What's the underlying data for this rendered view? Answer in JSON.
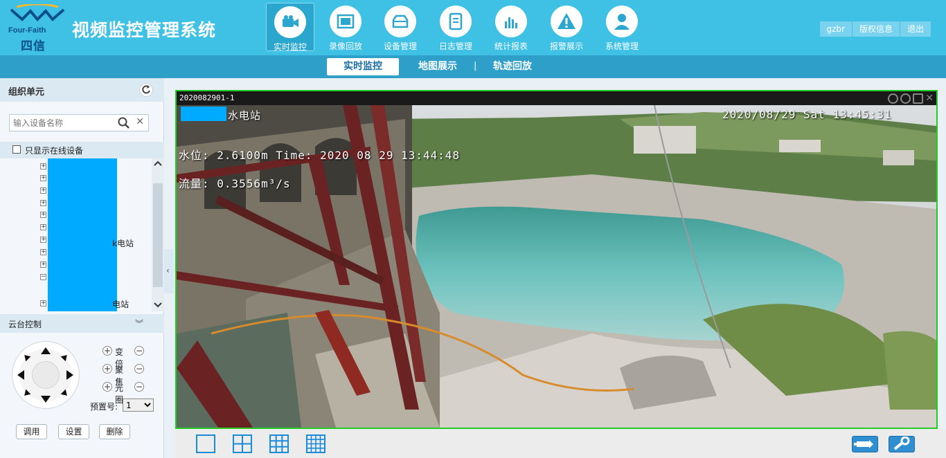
{
  "header": {
    "logo_brand": "Four-Faith",
    "logo_cn": "四信",
    "app_title": "视频监控管理系统",
    "nav": [
      {
        "label": "实时监控",
        "icon": "video-camera-icon",
        "active": true
      },
      {
        "label": "录像回放",
        "icon": "film-icon",
        "active": false
      },
      {
        "label": "设备管理",
        "icon": "device-icon",
        "active": false
      },
      {
        "label": "日志管理",
        "icon": "notebook-icon",
        "active": false
      },
      {
        "label": "统计报表",
        "icon": "bar-chart-icon",
        "active": false
      },
      {
        "label": "报警展示",
        "icon": "warning-icon",
        "active": false
      },
      {
        "label": "系统管理",
        "icon": "user-icon",
        "active": false
      }
    ],
    "top_buttons": [
      "gzbr",
      "版权信息",
      "退出"
    ]
  },
  "subnav": {
    "tabs": [
      "实时监控",
      "地图展示",
      "轨迹回放"
    ],
    "separator": "|"
  },
  "left": {
    "org_title": "组织单元",
    "search_placeholder": "输入设备名称",
    "online_only_label": "只显示在线设备",
    "tree_visible_texts": [
      "水电站",
      "电站"
    ],
    "ptz_title": "云台控制",
    "zoom_label": "变倍",
    "focus_label": "聚焦",
    "iris_label": "光圈",
    "preset_label": "预置号:",
    "preset_value": "1",
    "call_button": "调用",
    "set_button": "设置",
    "delete_button": "删除"
  },
  "video": {
    "channel_name": "2020082901-1",
    "osd_station": "水电站",
    "osd_datetime": "2020/08/29  Sat  13:45:31",
    "osd_water_level": "水位:  2.6100m    Time:  2020  08   29  13:44:48",
    "osd_flow": "流量:  0.3556m³/s"
  },
  "colors": {
    "header_bg": "#3fc1e6",
    "subnav_bg": "#2e9fc8",
    "mask_blue": "#00aaff",
    "video_border": "#22cc22"
  }
}
